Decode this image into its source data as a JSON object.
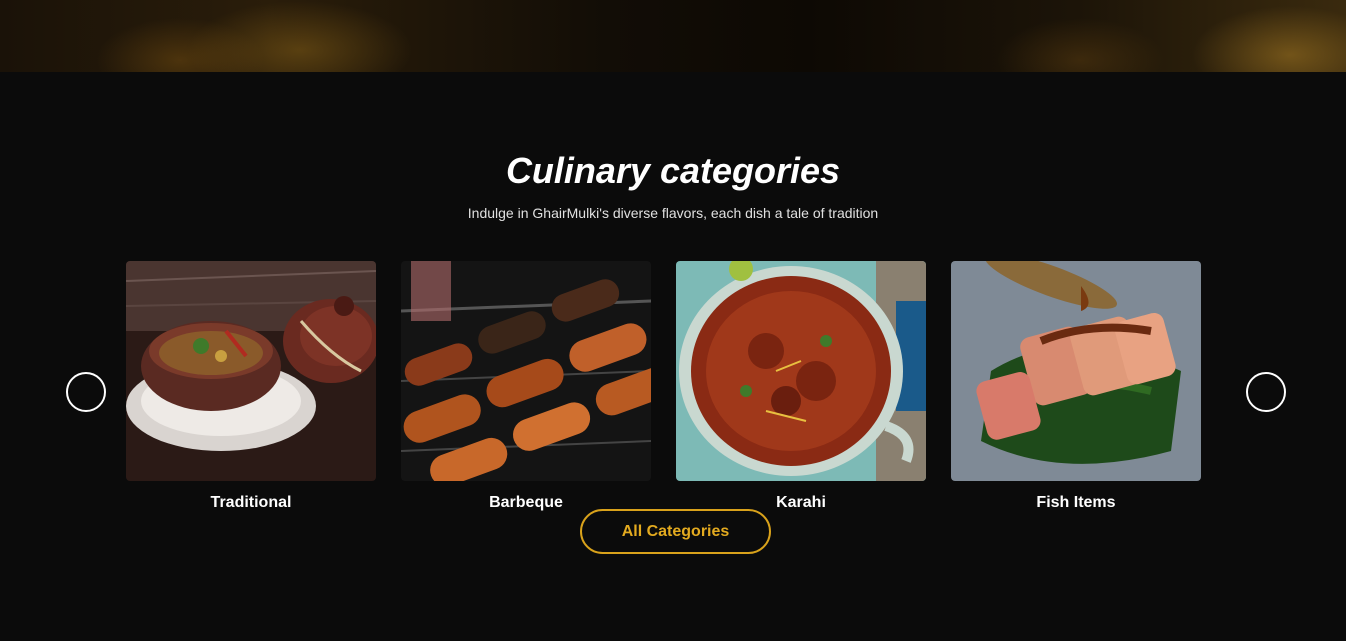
{
  "section": {
    "title": "Culinary categories",
    "subtitle": "Indulge in GhairMulki's diverse flavors, each dish a tale of tradition"
  },
  "categories": [
    {
      "label": "Traditional",
      "image": "clay-pot-curry-image"
    },
    {
      "label": "Barbeque",
      "image": "grilled-kebabs-image"
    },
    {
      "label": "Karahi",
      "image": "karahi-pan-image"
    },
    {
      "label": "Fish Items",
      "image": "seared-fish-image"
    }
  ],
  "buttons": {
    "all_categories": "All Categories",
    "prev": "",
    "next": ""
  },
  "colors": {
    "background": "#0b0b0b",
    "accent": "#e3aa1f",
    "text": "#ffffff"
  }
}
